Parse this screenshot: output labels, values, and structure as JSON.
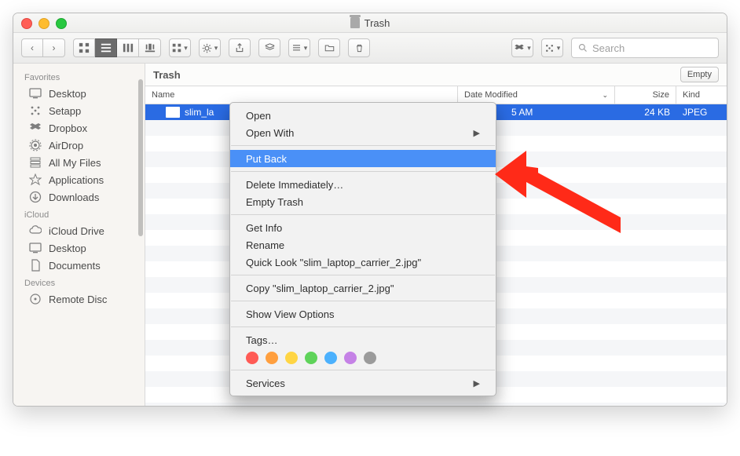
{
  "window": {
    "title": "Trash"
  },
  "toolbar": {
    "search_placeholder": "Search"
  },
  "sidebar": {
    "sections": [
      {
        "header": "Favorites",
        "items": [
          {
            "icon": "desktop-icon",
            "label": "Desktop"
          },
          {
            "icon": "setapp-icon",
            "label": "Setapp"
          },
          {
            "icon": "dropbox-icon",
            "label": "Dropbox"
          },
          {
            "icon": "airdrop-icon",
            "label": "AirDrop"
          },
          {
            "icon": "allmyfiles-icon",
            "label": "All My Files"
          },
          {
            "icon": "applications-icon",
            "label": "Applications"
          },
          {
            "icon": "downloads-icon",
            "label": "Downloads"
          }
        ]
      },
      {
        "header": "iCloud",
        "items": [
          {
            "icon": "icloud-icon",
            "label": "iCloud Drive"
          },
          {
            "icon": "desktop-icon",
            "label": "Desktop"
          },
          {
            "icon": "documents-icon",
            "label": "Documents"
          }
        ]
      },
      {
        "header": "Devices",
        "items": [
          {
            "icon": "remote-disc-icon",
            "label": "Remote Disc"
          }
        ]
      }
    ]
  },
  "location": {
    "title": "Trash",
    "empty_label": "Empty"
  },
  "columns": {
    "name": "Name",
    "date": "Date Modified",
    "size": "Size",
    "kind": "Kind"
  },
  "files": [
    {
      "name": "slim_la",
      "date_suffix": "5 AM",
      "size": "24 KB",
      "kind": "JPEG"
    }
  ],
  "context_menu": {
    "open": "Open",
    "open_with": "Open With",
    "put_back": "Put Back",
    "delete_immediately": "Delete Immediately…",
    "empty_trash": "Empty Trash",
    "get_info": "Get Info",
    "rename": "Rename",
    "quick_look": "Quick Look \"slim_laptop_carrier_2.jpg\"",
    "copy": "Copy \"slim_laptop_carrier_2.jpg\"",
    "show_view_options": "Show View Options",
    "tags": "Tags…",
    "services": "Services",
    "tag_colors": [
      "#ff5b55",
      "#ff9f3e",
      "#ffd544",
      "#5fd35a",
      "#4cb1fd",
      "#c582e6",
      "#9b9b9b"
    ]
  }
}
